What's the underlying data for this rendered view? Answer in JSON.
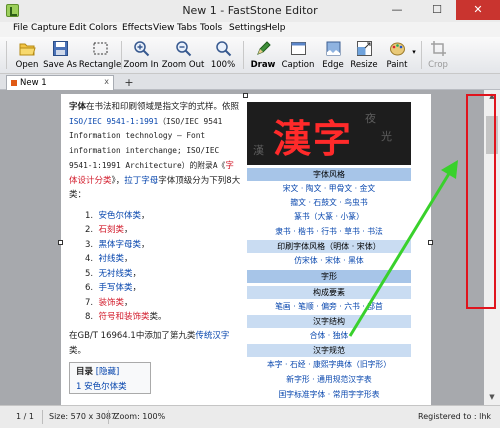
{
  "window": {
    "title": "New 1 - FastStone Editor",
    "minimize": "—",
    "maximize": "☐",
    "close": "✕"
  },
  "menu": [
    "File",
    "Capture",
    "Edit",
    "Colors",
    "Effects",
    "View",
    "Tabs",
    "Tools",
    "Settings",
    "Help"
  ],
  "toolbar": {
    "open": "Open",
    "save_as": "Save As",
    "rectangle": "Rectangle",
    "zoom_in": "Zoom In",
    "zoom_out": "Zoom Out",
    "zoom_value": "100%",
    "draw": "Draw",
    "caption": "Caption",
    "edge": "Edge",
    "resize": "Resize",
    "paint": "Paint",
    "crop": "Crop"
  },
  "tabs": {
    "active_tab": "New 1",
    "close": "x",
    "add": "+"
  },
  "status": {
    "page": "1 / 1",
    "size": "Size: 570 x 3087",
    "zoom": "Zoom: 100%",
    "registered": "Registered to : lhk"
  },
  "colors": {
    "accent_red": "#e0141d",
    "arrow_green": "#39d12c",
    "link": "#0645ad"
  },
  "doc": {
    "p1_a": "字体",
    "p1_b": "在书法和印刷领域是指文字的式样。依照",
    "p1_c": "ISO/IEC 9541-1:1991",
    "p1_d": "（ISO/IEC 9541 Information technology – Font information interchange; ISO/IEC 9541-1:1991 Architecture）的附录A《",
    "p1_e": "字体设计分类",
    "p1_f": "》，",
    "p1_g": "拉丁字母",
    "p1_h": "字体顶级分为下列8大类：",
    "list": [
      {
        "n": "1.",
        "t": "安色尔体类",
        "s": "，",
        "c": "link"
      },
      {
        "n": "2.",
        "t": "石刻类",
        "s": "，",
        "c": "red"
      },
      {
        "n": "3.",
        "t": "黑体字母类",
        "s": "，",
        "c": "link"
      },
      {
        "n": "4.",
        "t": "衬线类",
        "s": "，",
        "c": "link"
      },
      {
        "n": "5.",
        "t": "无衬线类",
        "s": "，",
        "c": "link"
      },
      {
        "n": "6.",
        "t": "手写体类",
        "s": "，",
        "c": "link"
      },
      {
        "n": "7.",
        "t": "装饰类",
        "s": "，",
        "c": "red"
      },
      {
        "n": "8.",
        "t": "符号和装饰类",
        "s": "类。",
        "c": "red"
      }
    ],
    "p2_a": "在GB/T 16964.1中添加了第九类",
    "p2_b": "传统汉字",
    "p2_c": "类。",
    "toc_title": "目录",
    "toc_hide": "[隐藏]",
    "toc_item": "1 安色尔体类"
  },
  "infobox": {
    "image_text": "漢字",
    "faint_1": "夜",
    "faint_2": "光",
    "faint_3": "漢",
    "h1": "字体风格",
    "r1": "宋文 · 陶文 · 甲骨文 · 金文",
    "r2": "籀文 · 石鼓文 · 鸟虫书",
    "r3": "篆书（大篆 · 小篆）",
    "r4": "隶书 · 楷书 · 行书 · 草书 · 书法",
    "h2": "印刷字体风格（明体 · 宋体）",
    "r5": "仿宋体 · 宋体 · 黑体",
    "h3": "字形",
    "h4": "构成要素",
    "r6": "笔画 · 笔顺 · 偏旁 · 六书 · 部首",
    "h5": "汉字结构",
    "r7": "合体 · 独体",
    "h6": "汉字规范",
    "r8": "本字 · 石经 · 康熙字典体（旧字形）",
    "r9": "新字形 · 通用规范汉字表",
    "r10": "国字标准字体 · 常用字字形表"
  }
}
